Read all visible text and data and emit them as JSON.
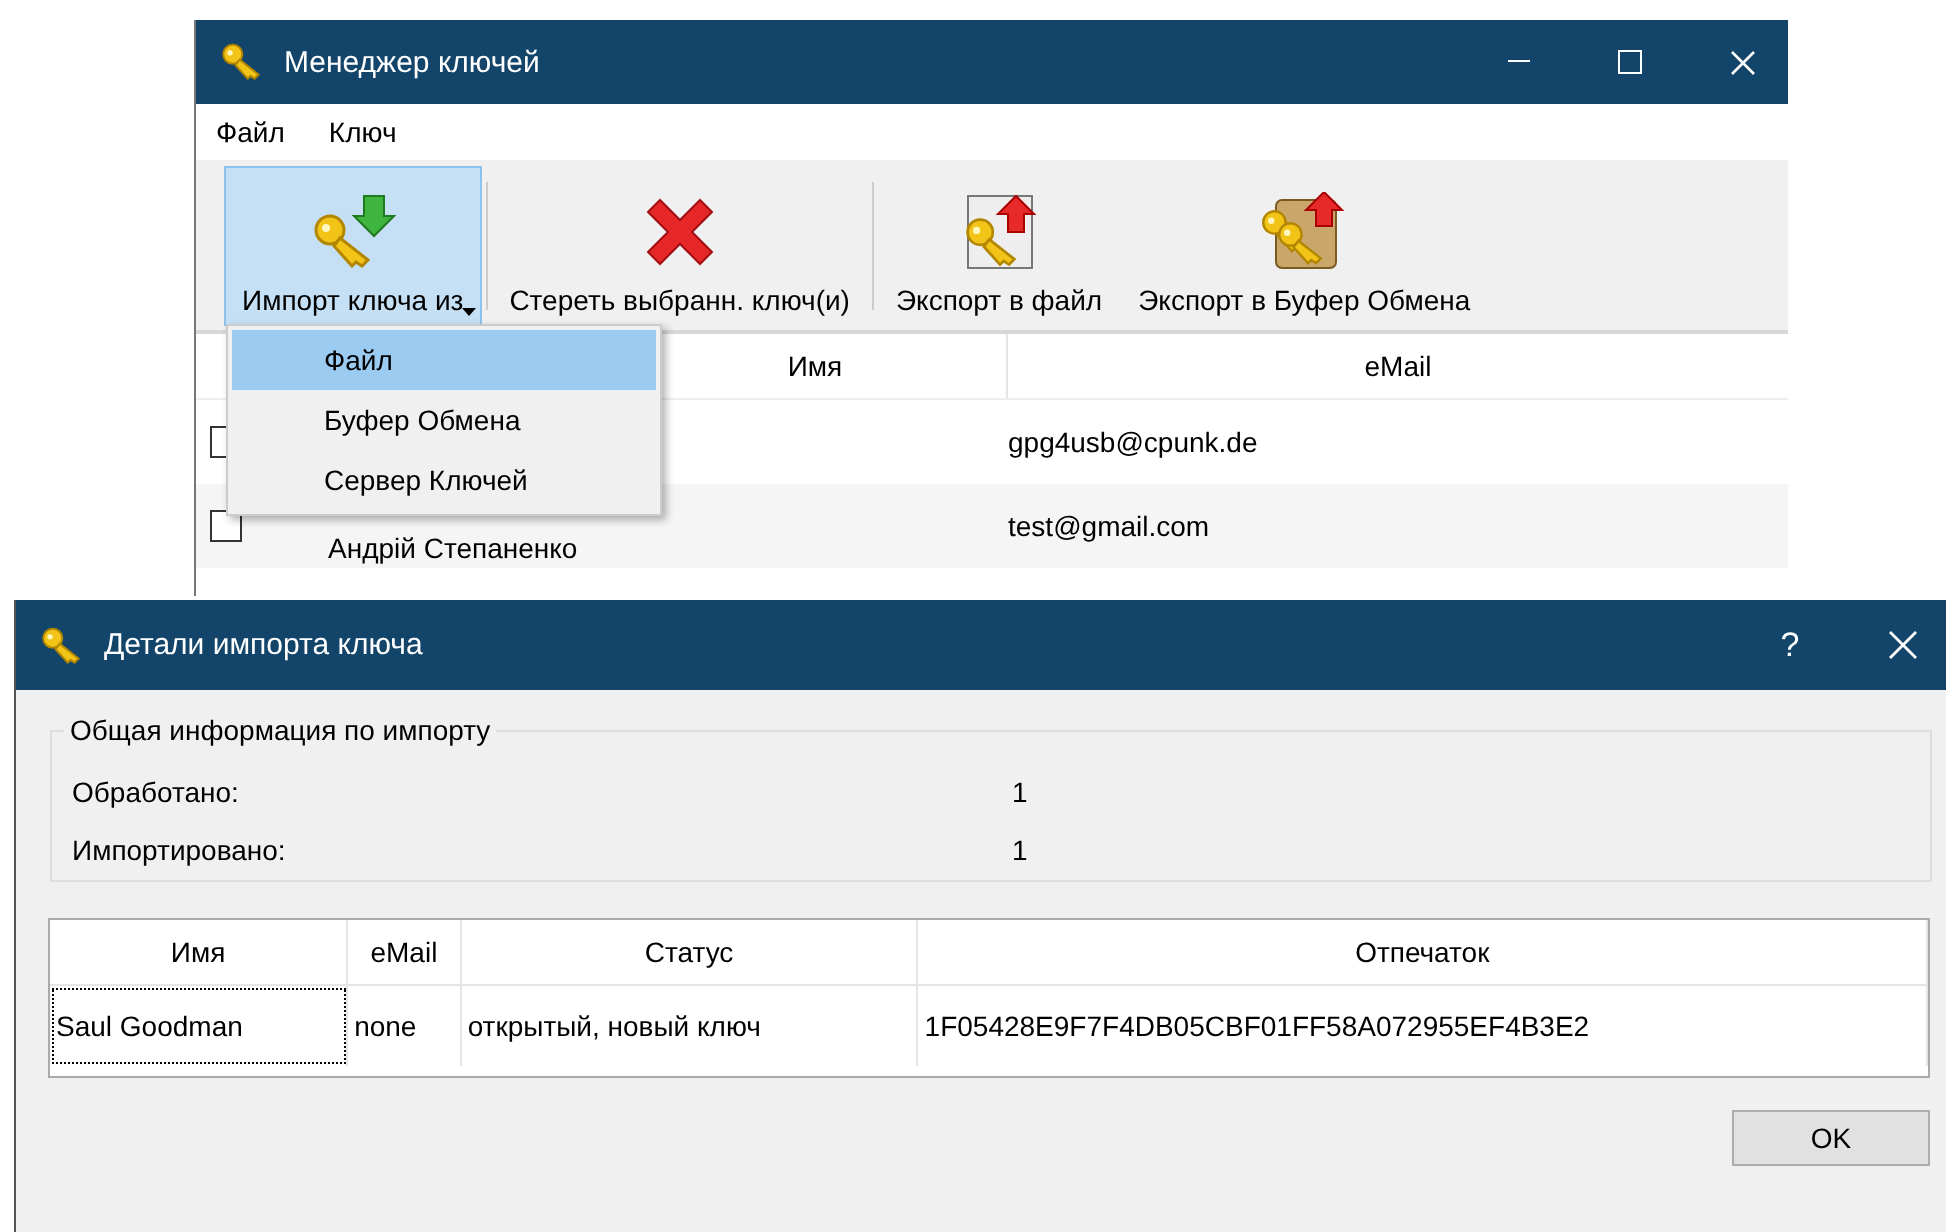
{
  "key_manager": {
    "title": "Менеджер ключей",
    "menu": [
      "Файл",
      "Ключ"
    ],
    "toolbar": [
      {
        "kind": "import",
        "label": "Импорт ключа из",
        "selected": true
      },
      {
        "kind": "delete",
        "label": "Стереть выбранн. ключ(и)",
        "selected": false
      },
      {
        "kind": "export_file",
        "label": "Экспорт в файл",
        "selected": false
      },
      {
        "kind": "export_clipboard",
        "label": "Экспорт в Буфер Обмена",
        "selected": false
      }
    ],
    "import_menu": [
      {
        "label": "Файл",
        "selected": true
      },
      {
        "label": "Буфер Обмена",
        "selected": false
      },
      {
        "label": "Сервер Ключей",
        "selected": false
      }
    ],
    "table": {
      "columns": [
        "Имя",
        "eMail"
      ],
      "rows": [
        {
          "checked": false,
          "email": "gpg4usb@cpunk.de"
        },
        {
          "checked": false,
          "name": "Андрій Степаненко",
          "email": "test@gmail.com"
        }
      ]
    }
  },
  "import_dialog": {
    "title": "Детали импорта ключа",
    "help": "?",
    "summary": {
      "title": "Общая информация по импорту",
      "rows": [
        {
          "label": "Обработано:",
          "value": "1"
        },
        {
          "label": "Импортировано:",
          "value": "1"
        }
      ]
    },
    "table": {
      "columns": [
        "Имя",
        "eMail",
        "Статус",
        "Отпечаток"
      ],
      "rows": [
        {
          "cells": [
            {
              "text": "Saul Goodman",
              "focused": true
            },
            {
              "text": "none",
              "focused": false
            },
            {
              "text": "открытый, новый ключ",
              "focused": false
            },
            {
              "text": "1F05428E9F7F4DB05CBF01FF58A072955EF4B3E2",
              "focused": false
            }
          ]
        }
      ]
    },
    "ok_button": "OK"
  }
}
